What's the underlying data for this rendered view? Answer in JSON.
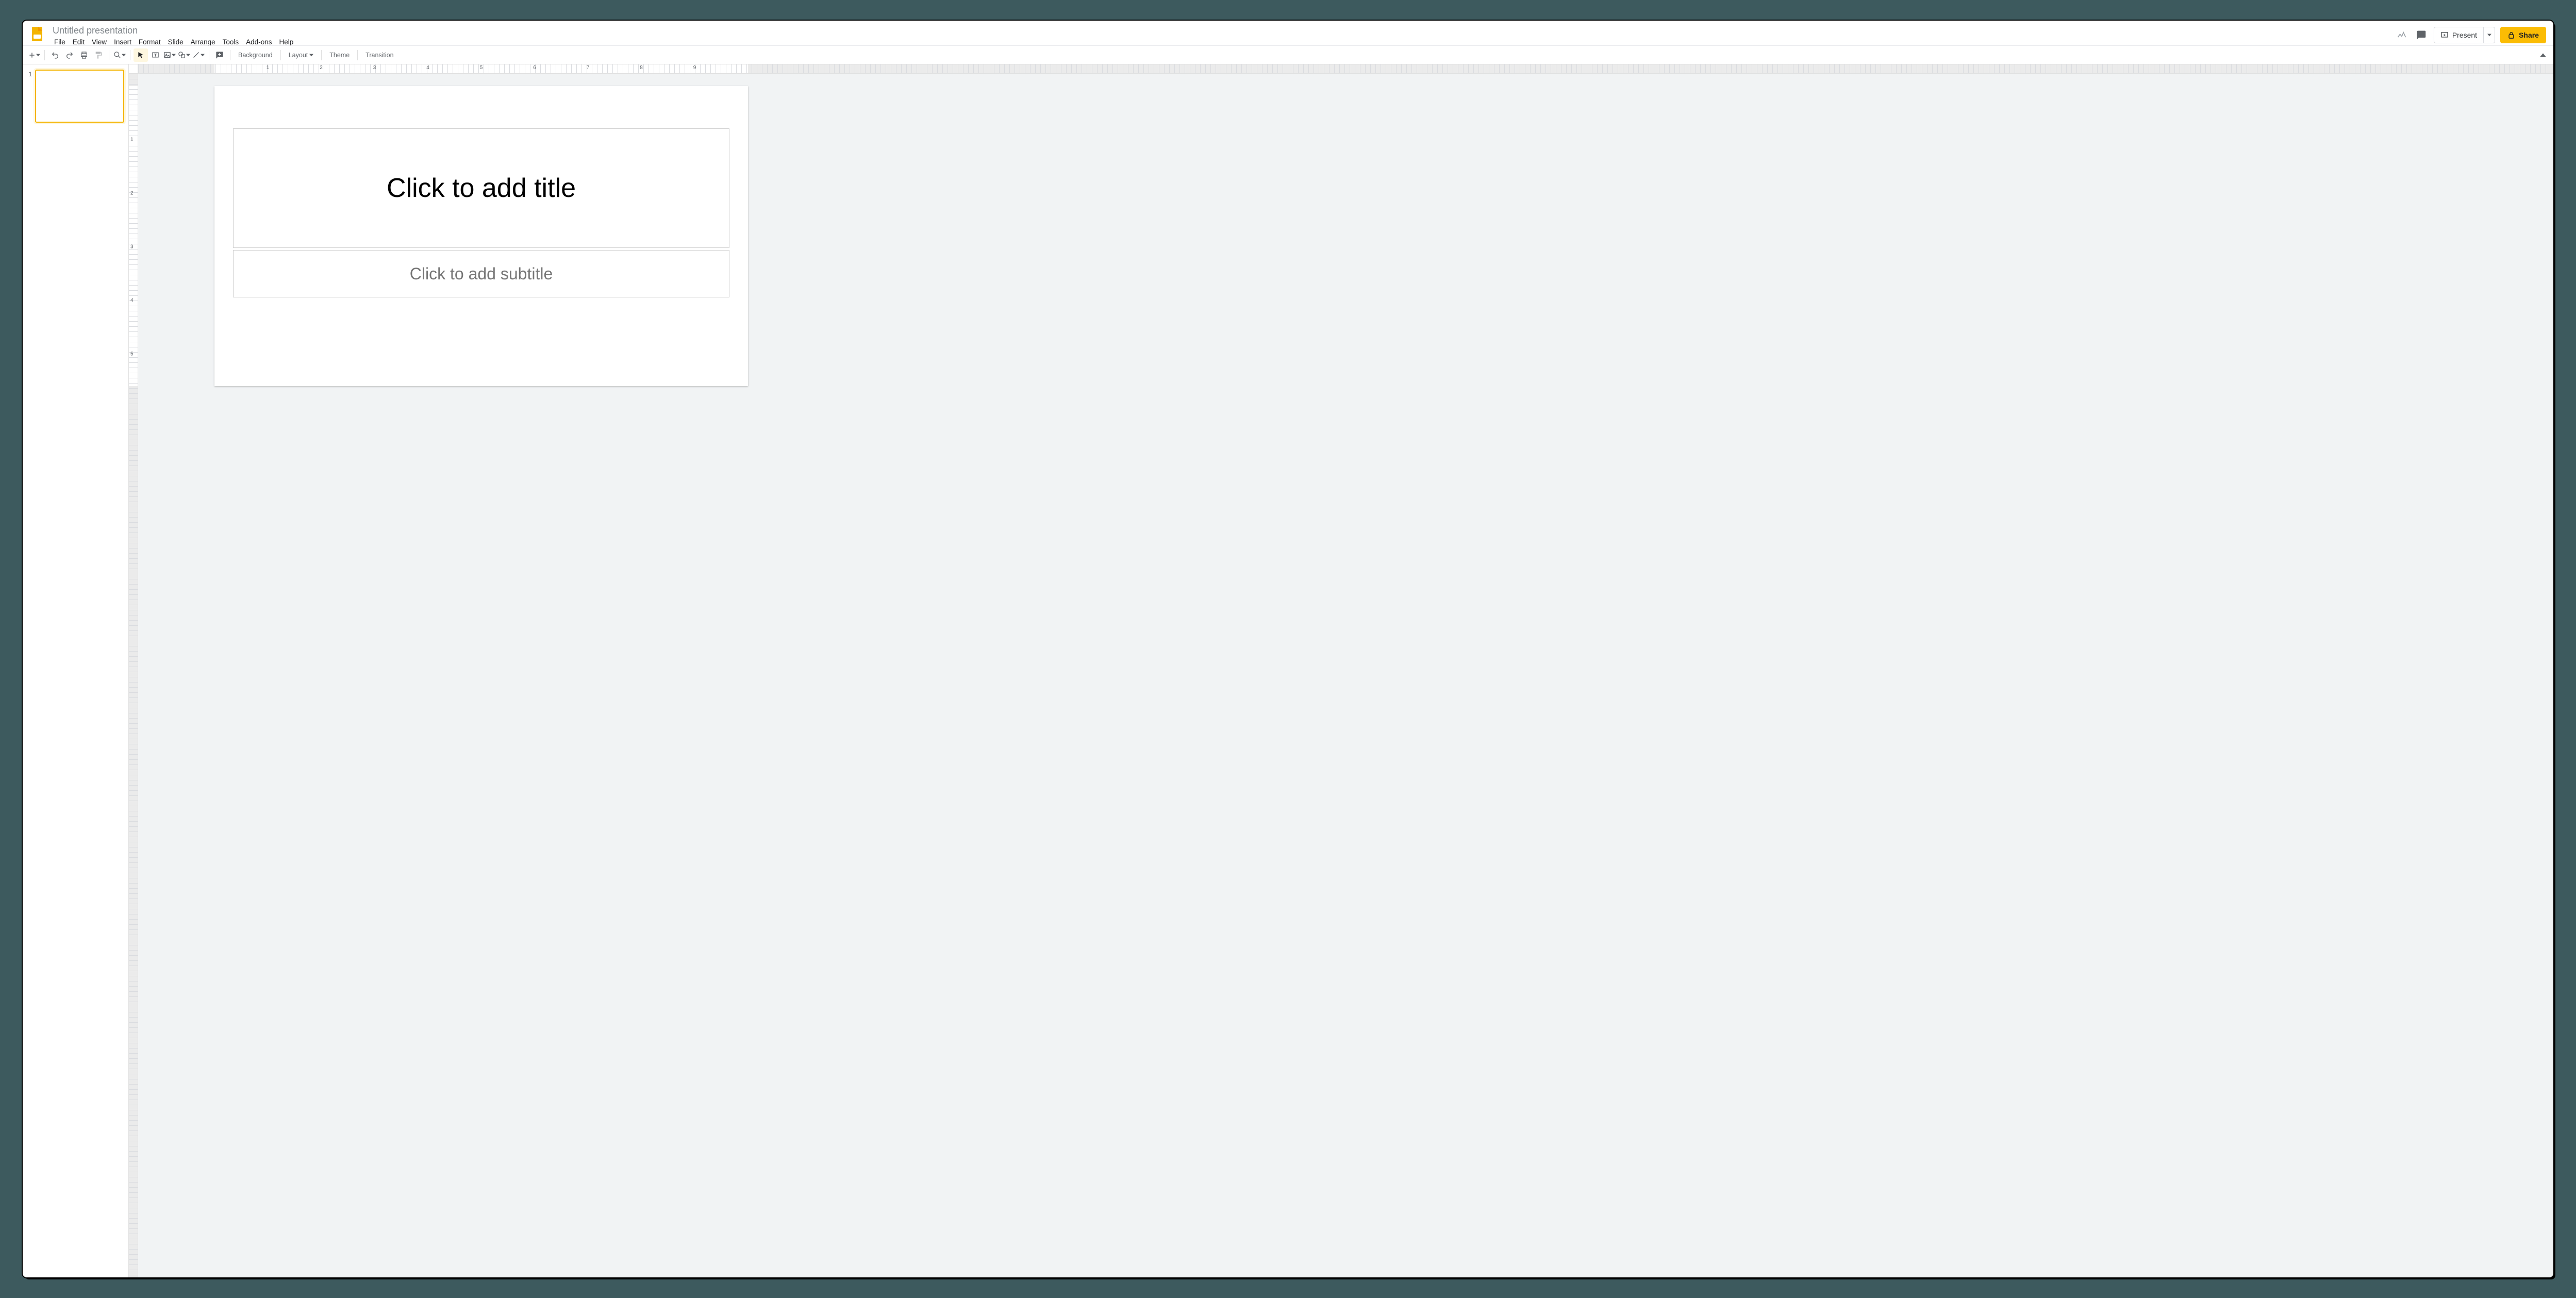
{
  "doc": {
    "title": "Untitled presentation"
  },
  "menus": {
    "file": "File",
    "edit": "Edit",
    "view": "View",
    "insert": "Insert",
    "format": "Format",
    "slide": "Slide",
    "arrange": "Arrange",
    "tools": "Tools",
    "addons": "Add-ons",
    "help": "Help"
  },
  "titlebar": {
    "present": "Present",
    "share": "Share"
  },
  "toolbar": {
    "background": "Background",
    "layout": "Layout",
    "theme": "Theme",
    "transition": "Transition"
  },
  "ruler": {
    "h": [
      "1",
      "2",
      "3",
      "4",
      "5",
      "6",
      "7",
      "8",
      "9"
    ],
    "v": [
      "1",
      "2",
      "3",
      "4",
      "5"
    ]
  },
  "film": {
    "0": {
      "num": "1"
    }
  },
  "slide": {
    "title_placeholder": "Click to add title",
    "subtitle_placeholder": "Click to add subtitle"
  }
}
